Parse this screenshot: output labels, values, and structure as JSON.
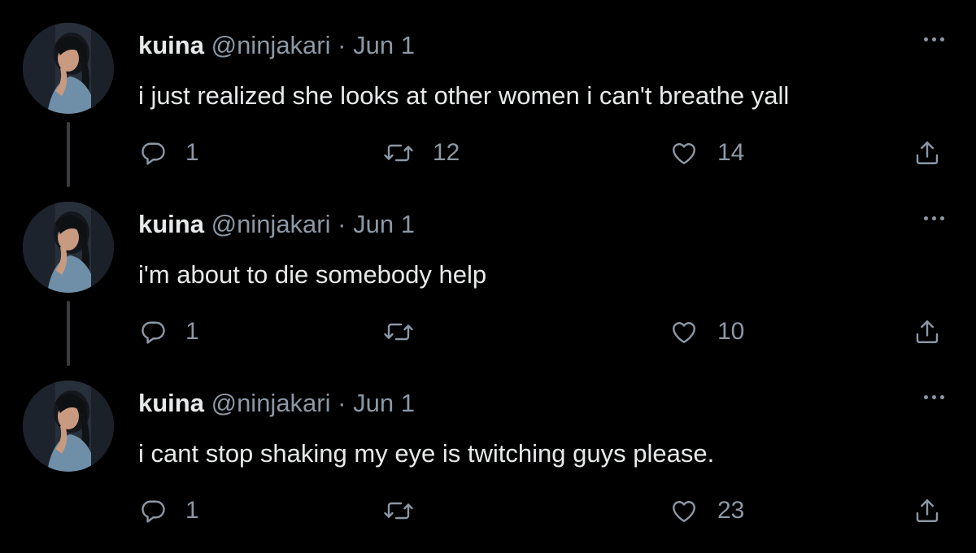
{
  "colors": {
    "background": "#000000",
    "primary_text": "#e7e9ea",
    "secondary_text": "#8b98a5",
    "thread_line": "#3a3d40"
  },
  "tweets": [
    {
      "author": {
        "name": "kuina",
        "handle": "@ninjakari"
      },
      "separator": "·",
      "date": "Jun 1",
      "text": "i just realized she looks at other women i can't breathe yall",
      "reply_count": "1",
      "retweet_count": "12",
      "like_count": "14"
    },
    {
      "author": {
        "name": "kuina",
        "handle": "@ninjakari"
      },
      "separator": "·",
      "date": "Jun 1",
      "text": "i'm about to die somebody help",
      "reply_count": "1",
      "retweet_count": "",
      "like_count": "10"
    },
    {
      "author": {
        "name": "kuina",
        "handle": "@ninjakari"
      },
      "separator": "·",
      "date": "Jun 1",
      "text": "i cant stop shaking my eye is twitching guys please.",
      "reply_count": "1",
      "retweet_count": "",
      "like_count": "23"
    }
  ],
  "icons": {
    "more": "more-icon",
    "reply": "reply-icon",
    "retweet": "retweet-icon",
    "like": "heart-icon",
    "share": "share-icon"
  }
}
